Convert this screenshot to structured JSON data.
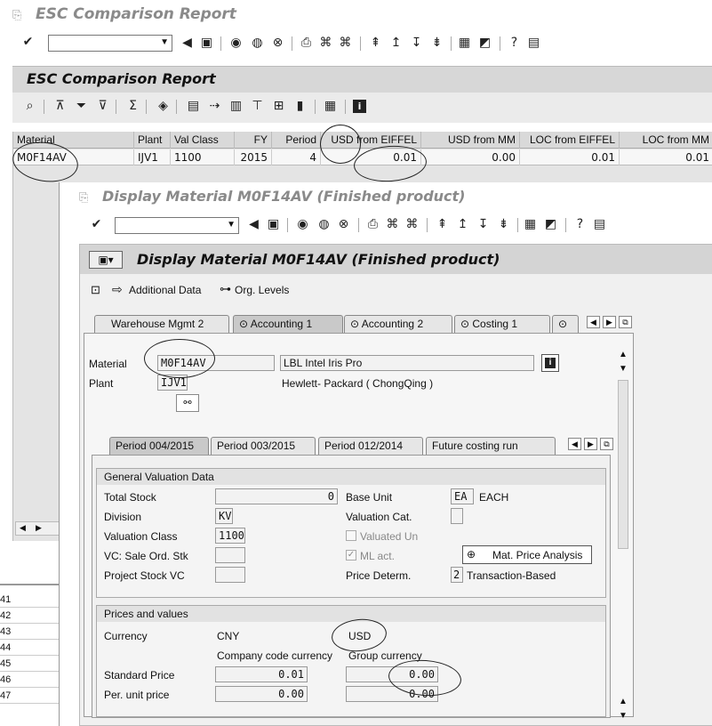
{
  "outer": {
    "title": "ESC Comparison Report",
    "report_header": "ESC Comparison Report"
  },
  "grid": {
    "columns": [
      "Material",
      "Plant",
      "Val Class",
      "FY",
      "Period",
      "USD from EIFFEL",
      "USD from MM",
      "LOC from EIFFEL",
      "LOC from MM"
    ],
    "row": [
      "M0F14AV",
      "IJV1",
      "1100",
      "2015",
      "4",
      "0.01",
      "0.00",
      "0.01",
      "0.01"
    ]
  },
  "spreadsheet": {
    "row_numbers": [
      "41",
      "42",
      "43",
      "44",
      "45",
      "46",
      "47"
    ]
  },
  "display": {
    "window_title": "Display Material M0F14AV (Finished product)",
    "header_title": "Display Material M0F14AV (Finished product)",
    "additional_data": "Additional Data",
    "org_levels": "Org. Levels",
    "tabs": [
      "Warehouse Mgmt 2",
      "Accounting 1",
      "Accounting 2",
      "Costing 1"
    ],
    "material_label": "Material",
    "material_value": "M0F14AV",
    "material_desc": "LBL Intel Iris Pro",
    "plant_label": "Plant",
    "plant_value": "IJV1",
    "plant_desc": "Hewlett- Packard ( ChongQing )",
    "period_tabs": [
      "Period 004/2015",
      "Period 003/2015",
      "Period 012/2014",
      "Future costing run"
    ],
    "gvd": {
      "title": "General Valuation Data",
      "total_stock_label": "Total Stock",
      "total_stock_value": "0",
      "base_unit_label": "Base Unit",
      "base_unit_value": "EA",
      "base_unit_text": "EACH",
      "division_label": "Division",
      "division_value": "KV",
      "valuation_cat_label": "Valuation Cat.",
      "valuation_class_label": "Valuation Class",
      "valuation_class_value": "1100",
      "valuated_un_label": "Valuated Un",
      "vc_sale_label": "VC: Sale Ord. Stk",
      "ml_act_label": "ML act.",
      "mat_price_button": "Mat. Price Analysis",
      "project_stock_label": "Project Stock VC",
      "price_determ_label": "Price Determ.",
      "price_determ_value": "2",
      "price_determ_text": "Transaction-Based"
    },
    "prices": {
      "title": "Prices and values",
      "currency_label": "Currency",
      "currency_cc": "CNY",
      "currency_gc": "USD",
      "company_code_currency": "Company code currency",
      "group_currency": "Group currency",
      "standard_price_label": "Standard Price",
      "standard_price_cc": "0.01",
      "standard_price_gc": "0.00",
      "per_unit_label": "Per. unit price",
      "per_unit_cc": "0.00",
      "per_unit_gc": "0.00"
    }
  }
}
